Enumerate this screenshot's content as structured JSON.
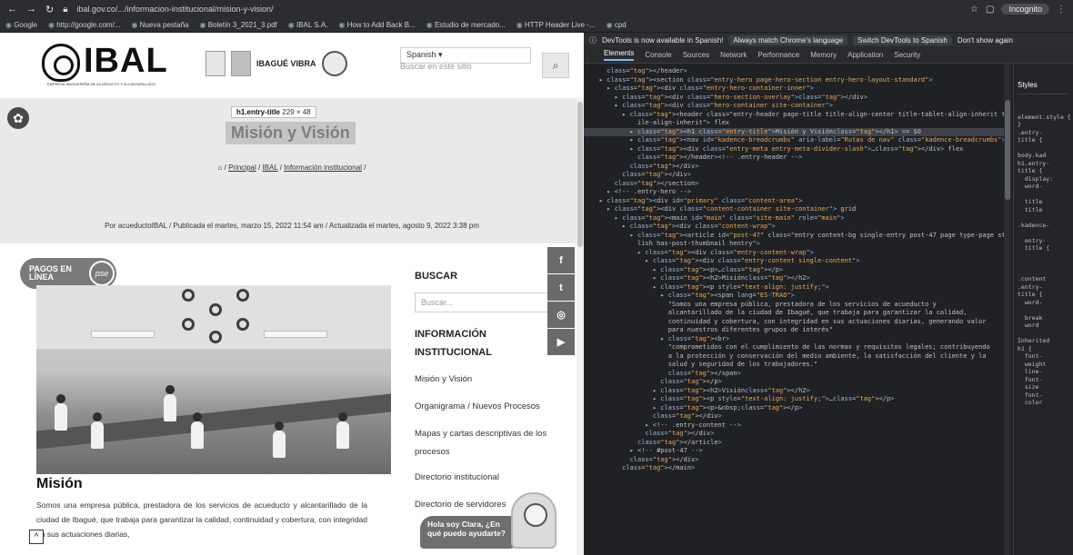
{
  "browser": {
    "url": "ibal.gov.co/.../informacion-institucional/mision-y-vision/",
    "profile_label": "Incognito",
    "bookmarks": [
      "Google",
      "http://google.com/...",
      "Nueva pestaña",
      "Boletín 3_2021_3.pdf",
      "IBAL S.A.",
      "How to Add Back B...",
      "Estudio de mercado...",
      "HTTP Header Live -...",
      "cpd"
    ]
  },
  "site": {
    "logo_text": "IBAL",
    "logo_subtitle": "EMPRESA IBAGUEREÑA DE ACUEDUCTO Y ALCANTARILLADO",
    "vibra_label": "IBAGUÉ VIBRA",
    "language": "Spanish",
    "search_placeholder": "Buscar en este sitio",
    "tooltip_tag": "h1.entry-title",
    "tooltip_dims": "229 × 48",
    "page_title": "Misión y Visión",
    "breadcrumbs": [
      "Principal",
      "IBAL",
      "Información institucional"
    ],
    "meta": "Por acueductoIBAL / Publicada el martes, marzo 15, 2022 11:54 am / Actualizada el martes, agosto 9, 2022 3:38 pm",
    "pagos_label": "PAGOS EN LÍNEA",
    "pse_label": "pse",
    "mision_heading": "Misión",
    "mision_text": "Somos una empresa pública, prestadora de los servicios de acueducto y alcantarillado de la ciudad de Ibagué, que trabaja para garantizar la calidad, continuidad y cobertura, con integridad en sus actuaciones diarias,",
    "sidebar": {
      "search_title": "BUSCAR",
      "search_placeholder": "Buscar...",
      "info_title": "INFORMACIÓN INSTITUCIONAL",
      "links": [
        "Misión y Visión",
        "Organigrama / Nuevos Procesos",
        "Mapas y cartas descriptivas de los procesos",
        "Directorio institucional",
        "Directorio de servidores"
      ]
    },
    "chat_text": "Hola soy Clara, ¿En qué puedo ayudarte?"
  },
  "devtools": {
    "info_text": "DevTools is now available in Spanish!",
    "info_btn1": "Always match Chrome's language",
    "info_btn2": "Switch DevTools to Spanish",
    "info_btn3": "Don't show again",
    "tabs": [
      "Elements",
      "Console",
      "Sources",
      "Network",
      "Performance",
      "Memory",
      "Application",
      "Security"
    ],
    "active_tab": "Elements",
    "styles_tab": "Styles",
    "dom_lines": [
      {
        "indent": 2,
        "html": "</header>"
      },
      {
        "indent": 2,
        "html": "<section class=\"entry-hero page-hero-section entry-hero-layout-standard\">"
      },
      {
        "indent": 3,
        "html": "<div class=\"entry-hero-container-inner\">"
      },
      {
        "indent": 4,
        "html": "<div class=\"hero-section-overlay\"></div>"
      },
      {
        "indent": 4,
        "html": "<div class=\"hero-container site-container\">"
      },
      {
        "indent": 5,
        "html": "<header class=\"entry-header page-title title-align-center title-tablet-align-inherit title-mo"
      },
      {
        "indent": 6,
        "html": "ile-align-inherit\"> flex"
      },
      {
        "indent": 6,
        "html": "<h1 class=\"entry-title\">Misión y Visión</h1> == $0",
        "hl": true
      },
      {
        "indent": 6,
        "html": "<nav id=\"kadence-breadcrumbs\" aria-label=\"Rutas de nav\" class=\"kadence-breadcrumbs\">…</nav>"
      },
      {
        "indent": 6,
        "html": "<div class=\"entry-meta entry-meta-divider-slash\">…</div> flex"
      },
      {
        "indent": 6,
        "html": "</header><!-- .entry-header -->"
      },
      {
        "indent": 5,
        "html": "</div>"
      },
      {
        "indent": 4,
        "html": "</div>"
      },
      {
        "indent": 3,
        "html": "</section>"
      },
      {
        "indent": 3,
        "html": "<!-- .entry-hero -->"
      },
      {
        "indent": 2,
        "html": "<div id=\"primary\" class=\"content-area\">"
      },
      {
        "indent": 3,
        "html": "<div class=\"content-container site-container\"> grid"
      },
      {
        "indent": 4,
        "html": "<main id=\"main\" class=\"site-main\" role=\"main\">"
      },
      {
        "indent": 5,
        "html": "<div class=\"content-wrap\">"
      },
      {
        "indent": 6,
        "html": "<article id=\"post-47\" class=\"entry content-bg single-entry post-47 page type-page status-pub"
      },
      {
        "indent": 6,
        "html": "lish has-post-thumbnail hentry\">"
      },
      {
        "indent": 7,
        "html": "<div class=\"entry-content-wrap\">"
      },
      {
        "indent": 8,
        "html": "<div class=\"entry-content single-content\">"
      },
      {
        "indent": 9,
        "html": "<p>…</p>"
      },
      {
        "indent": 9,
        "html": "<h2>Misión</h2>"
      },
      {
        "indent": 9,
        "html": "<p style=\"text-align: justify;\">"
      },
      {
        "indent": 10,
        "html": "<span lang=\"ES-TRAD\">"
      },
      {
        "indent": 10,
        "html": "\"Somos una empresa pública, prestadora de los servicios de acueducto y"
      },
      {
        "indent": 10,
        "html": "alcantarillado de la ciudad de Ibagué, que trabaja para garantizar la calidad,"
      },
      {
        "indent": 10,
        "html": "continuidad y cobertura, con integridad en sus actuaciones diarias, generando valor"
      },
      {
        "indent": 10,
        "html": "para nuestros diferentes grupos de interés\""
      },
      {
        "indent": 10,
        "html": "<br>"
      },
      {
        "indent": 10,
        "html": "\"comprometidos con el cumplimiento de las normas y requisitos legales; contribuyendo"
      },
      {
        "indent": 10,
        "html": "a la protección y conservación del medio ambiente, la satisfacción del cliente y la"
      },
      {
        "indent": 10,
        "html": "salud y seguridad de los trabajadores.\""
      },
      {
        "indent": 10,
        "html": "</span>"
      },
      {
        "indent": 9,
        "html": "</p>"
      },
      {
        "indent": 9,
        "html": "<h2>Visión</h2>"
      },
      {
        "indent": 9,
        "html": "<p style=\"text-align: justify;\">…</p>"
      },
      {
        "indent": 9,
        "html": "<p>&nbsp;</p>"
      },
      {
        "indent": 8,
        "html": "</div>"
      },
      {
        "indent": 8,
        "html": "<!-- .entry-content -->"
      },
      {
        "indent": 7,
        "html": "</div>"
      },
      {
        "indent": 6,
        "html": "</article>"
      },
      {
        "indent": 6,
        "html": "<!-- #post-47 -->"
      },
      {
        "indent": 5,
        "html": "</div>"
      },
      {
        "indent": 4,
        "html": "</main>"
      }
    ],
    "styles_lines": [
      "element.style {",
      "}",
      ".entry-",
      "title {",
      "",
      "body.kad",
      "h1.entry-",
      "title {",
      "  display:",
      "  word-",
      "",
      "  title",
      "  title",
      "",
      ".kadence-",
      "",
      "  entry-",
      "  title {",
      "",
      "",
      "",
      ".content",
      ".entry-",
      "title {",
      "  word-",
      "",
      "  break",
      "  word",
      "",
      "Inherited",
      "h1 {",
      "  font-",
      "  weight",
      "  line-",
      "  font-",
      "  size",
      "  font-",
      "  color"
    ]
  }
}
